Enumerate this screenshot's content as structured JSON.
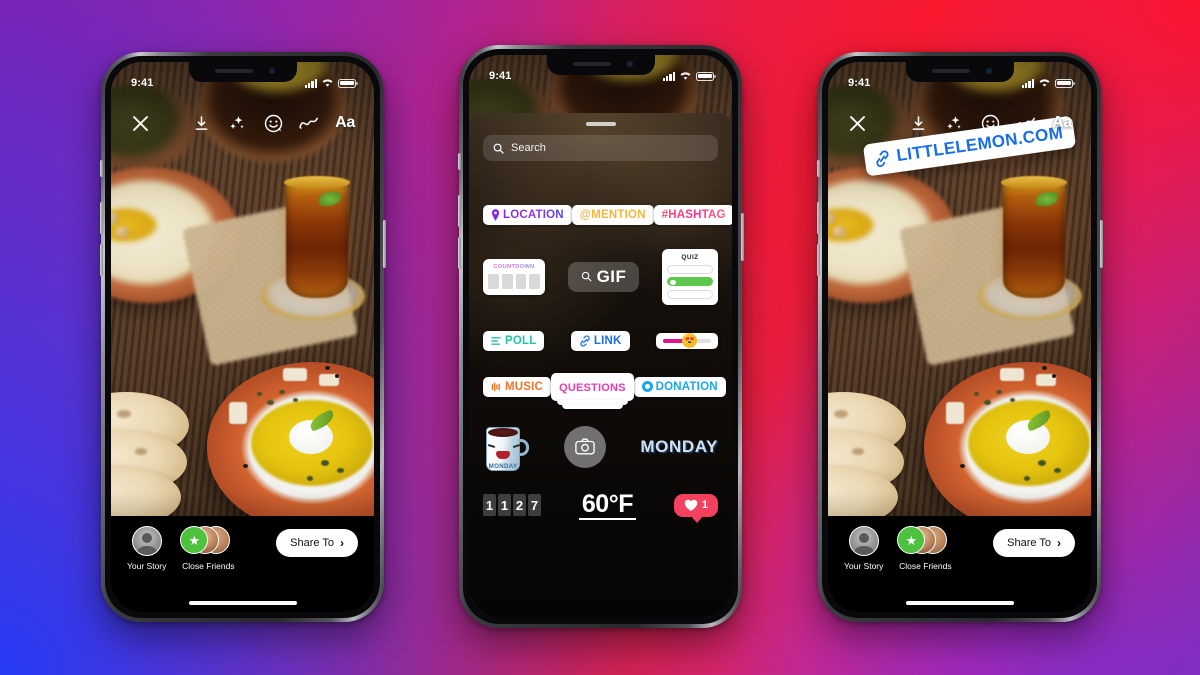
{
  "background": {
    "gradient_from": "#7b28b0",
    "gradient_mid": "#e31f4f",
    "gradient_to": "#1f46f5"
  },
  "status_bar": {
    "time": "9:41"
  },
  "toolbar": {
    "close_label": "✕",
    "save_icon": "download-icon",
    "effects_icon": "sparkles-icon",
    "sticker_icon": "sticker-face-icon",
    "draw_icon": "squiggle-draw-icon",
    "text_label": "Aa"
  },
  "bottom_bar": {
    "your_story_label": "Your Story",
    "close_friends_label": "Close Friends",
    "share_label": "Share To",
    "share_chevron": "›"
  },
  "sticker_tray": {
    "search": {
      "placeholder": "Search",
      "value": "Search",
      "icon": "search-icon"
    },
    "row1": [
      {
        "id": "location",
        "label": "LOCATION",
        "icon": "pin-icon",
        "color": "#7b2fe0"
      },
      {
        "id": "mention",
        "label": "@MENTION",
        "color": "#f2b73a"
      },
      {
        "id": "hashtag",
        "label": "#HASHTAG",
        "color": "#ff3f77"
      }
    ],
    "countdown": {
      "title": "COUNTDOWN",
      "cells": 4
    },
    "gif": {
      "label": "GIF",
      "icon": "search-icon"
    },
    "quiz": {
      "title": "QUIZ",
      "options": 3,
      "correct_index": 1,
      "correct_color": "#5fc64f"
    },
    "poll": {
      "label": "POLL",
      "color": "#24c4a8",
      "icon": "poll-bars-icon"
    },
    "link": {
      "label": "LINK",
      "color": "#1a6de8",
      "icon": "link-chain-icon"
    },
    "emoji_slider": {
      "emoji": "😍",
      "fill_percent": 48,
      "fill_color": "#e0167f"
    },
    "music": {
      "label": "MUSIC",
      "color": "#f0732a",
      "icon": "equalizer-icon"
    },
    "questions": {
      "label": "QUESTIONS",
      "color": "#e93bb0"
    },
    "donation": {
      "label": "DONATION",
      "color": "#1aa7e8",
      "icon": "donation-circle-icon"
    },
    "mug_sticker": {
      "word": "MONDAY"
    },
    "camera_sticker": {
      "icon": "camera-icon"
    },
    "monday_text_sticker": {
      "label": "MONDAY"
    },
    "digital_clock": {
      "digits": [
        "1",
        "1",
        "2",
        "7"
      ]
    },
    "temperature": {
      "value": "60°F"
    },
    "like_badge": {
      "count": "1",
      "icon": "heart-icon",
      "color": "#f3415e"
    }
  },
  "link_sticker": {
    "label": "LITTLELEMON.COM",
    "icon": "link-chain-icon",
    "color": "#1a6de8"
  }
}
